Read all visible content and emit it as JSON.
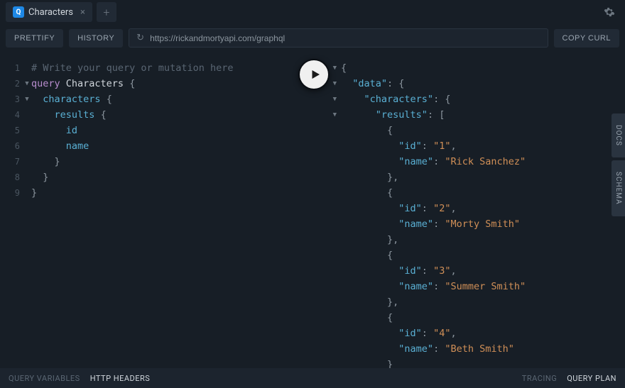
{
  "topbar": {
    "tab_label": "Characters",
    "tab_icon_letter": "Q"
  },
  "toolbar": {
    "prettify": "PRETTIFY",
    "history": "HISTORY",
    "copy_curl": "COPY CURL",
    "url": "https://rickandmortyapi.com/graphql"
  },
  "editor": {
    "comment": "# Write your query or mutation here",
    "keyword": "query",
    "op_name": "Characters",
    "field_characters": "characters",
    "field_results": "results",
    "field_id": "id",
    "field_name": "name"
  },
  "result": {
    "key_data": "\"data\"",
    "key_characters": "\"characters\"",
    "key_results": "\"results\"",
    "key_id": "\"id\"",
    "key_name": "\"name\"",
    "items": [
      {
        "id": "\"1\"",
        "name": "\"Rick Sanchez\""
      },
      {
        "id": "\"2\"",
        "name": "\"Morty Smith\""
      },
      {
        "id": "\"3\"",
        "name": "\"Summer Smith\""
      },
      {
        "id": "\"4\"",
        "name": "\"Beth Smith\""
      }
    ]
  },
  "sidetabs": {
    "docs": "DOCS",
    "schema": "SCHEMA"
  },
  "bottombar": {
    "query_variables": "QUERY VARIABLES",
    "http_headers": "HTTP HEADERS",
    "tracing": "TRACING",
    "query_plan": "QUERY PLAN"
  }
}
